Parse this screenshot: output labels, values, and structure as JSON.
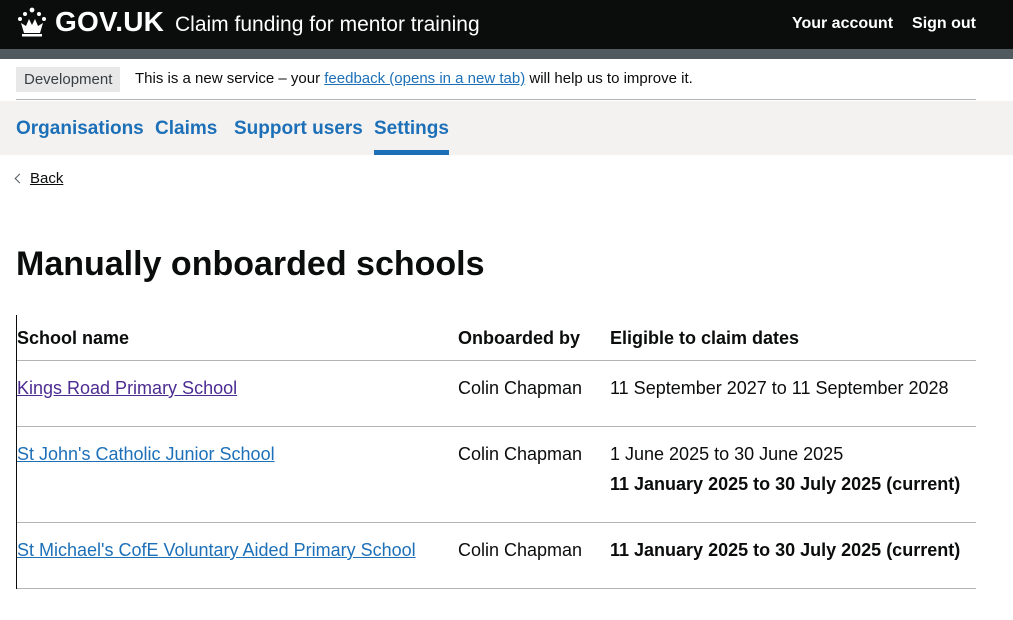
{
  "header": {
    "logo_text": "GOV.UK",
    "service_name": "Claim funding for mentor training",
    "nav": [
      "Your account",
      "Sign out"
    ]
  },
  "phase_banner": {
    "tag": "Development",
    "text_before": "This is a new service – your ",
    "link": "feedback (opens in a new tab)",
    "text_after": " will help us to improve it."
  },
  "subnav": {
    "items": [
      "Organisations",
      "Claims",
      "Support users",
      "Settings"
    ],
    "active": "Settings"
  },
  "back_link": "Back",
  "page_title": "Manually onboarded schools",
  "table": {
    "headers": [
      "School name",
      "Onboarded by",
      "Eligible to claim dates"
    ],
    "rows": [
      {
        "school": "Kings Road Primary School",
        "onboarded_by": "Colin Chapman",
        "dates": [
          "11 September 2027 to 11 September 2028"
        ],
        "current": ""
      },
      {
        "school": "St John's Catholic Junior School",
        "onboarded_by": "Colin Chapman",
        "dates": [
          "1 June 2025 to 30 June 2025"
        ],
        "current": "11 January 2025 to 30 July 2025 (current)"
      },
      {
        "school": "St Michael's CofE Voluntary Aided Primary School",
        "onboarded_by": "Colin Chapman",
        "dates": [],
        "current": "11 January 2025 to 30 July 2025 (current)"
      }
    ]
  },
  "colors": {
    "header_bg": "#0b0c0c",
    "link": "#1d70b8",
    "visited_link": "#4c2c92",
    "subnav_bg": "#f3f2f1"
  }
}
